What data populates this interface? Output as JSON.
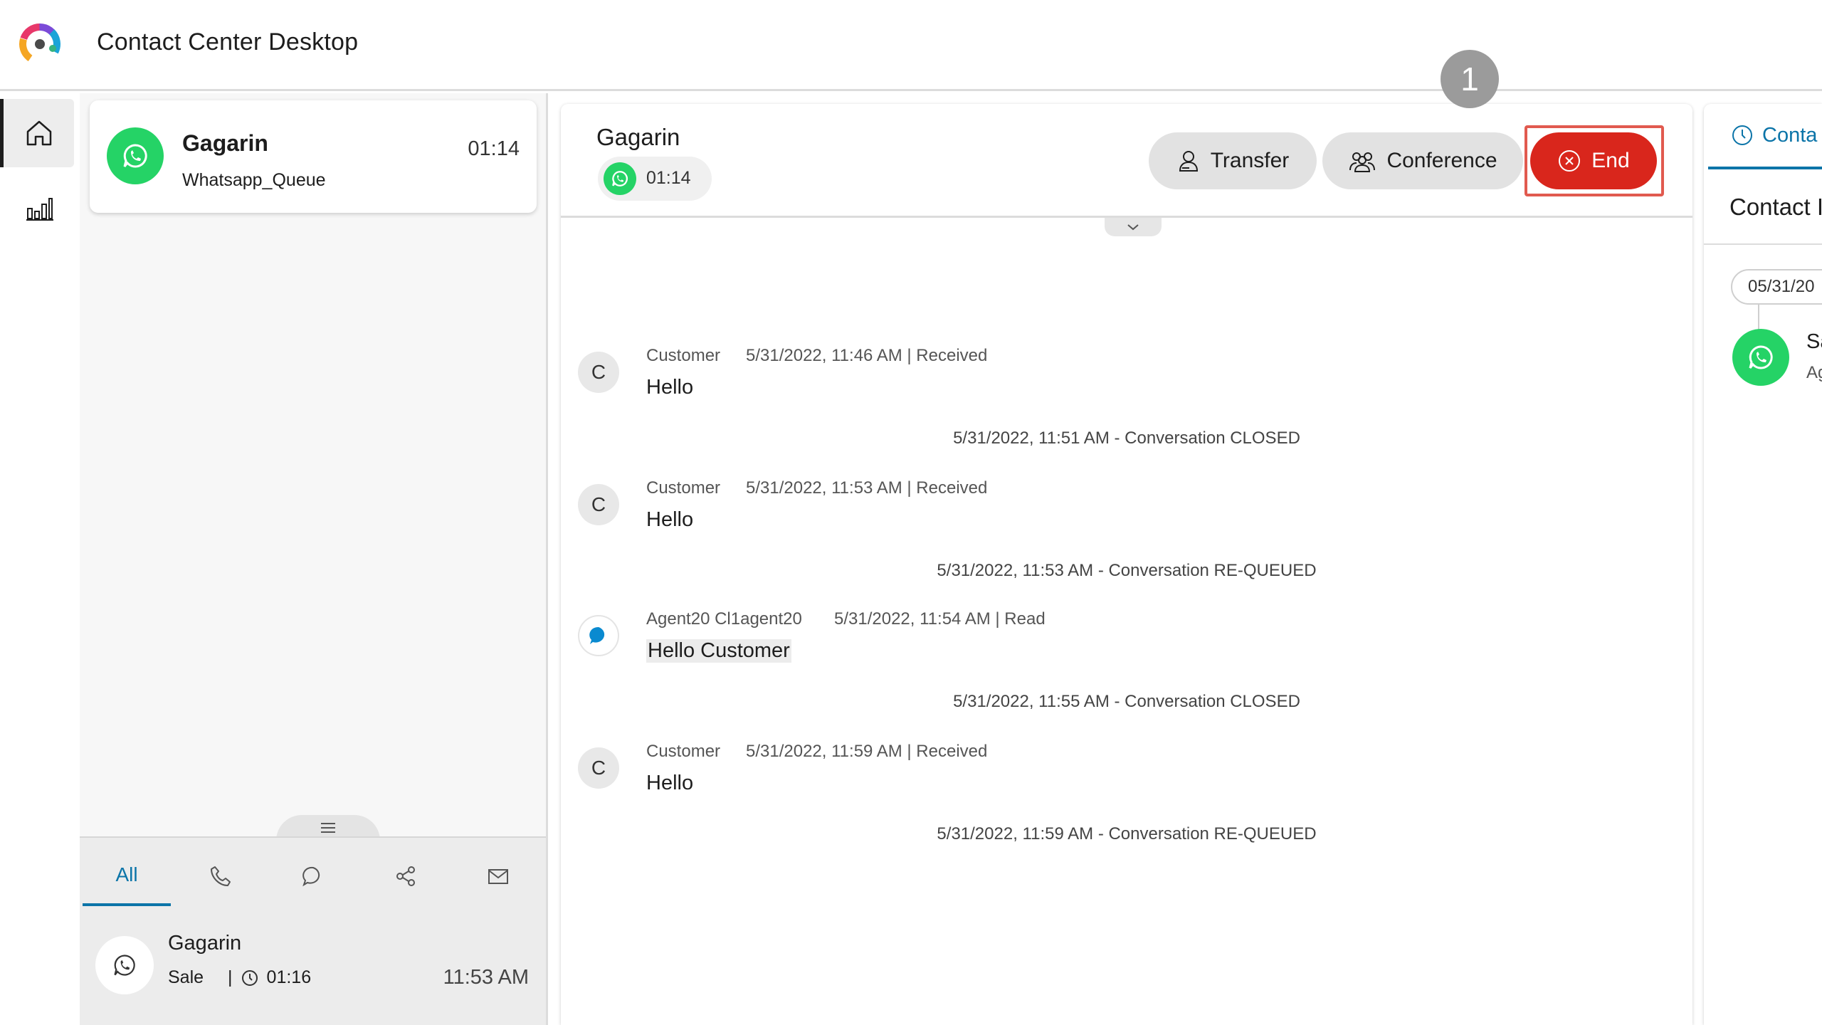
{
  "app": {
    "title": "Contact Center Desktop"
  },
  "task": {
    "name": "Gagarin",
    "queue": "Whatsapp_Queue",
    "timer": "01:14"
  },
  "drawer": {
    "tabs": [
      {
        "label": "All",
        "active": true
      },
      {
        "icon": "phone-icon"
      },
      {
        "icon": "chat-icon"
      },
      {
        "icon": "social-icon"
      },
      {
        "icon": "email-icon"
      }
    ],
    "history": {
      "name": "Gagarin",
      "label": "Sale",
      "separator": "|",
      "duration": "01:16",
      "time": "11:53 AM"
    }
  },
  "interaction": {
    "title": "Gagarin",
    "timer": "01:14",
    "buttons": {
      "transfer": "Transfer",
      "conference": "Conference",
      "end": "End"
    },
    "step_badge": "1",
    "messages": [
      {
        "kind": "msg",
        "avatar": "C",
        "sender": "Customer",
        "meta": "5/31/2022, 11:46 AM | Received",
        "text": "Hello"
      },
      {
        "kind": "sys",
        "text": "5/31/2022, 11:51 AM - Conversation CLOSED"
      },
      {
        "kind": "msg",
        "avatar": "C",
        "sender": "Customer",
        "meta": "5/31/2022, 11:53 AM | Received",
        "text": "Hello"
      },
      {
        "kind": "sys",
        "text": "5/31/2022, 11:53 AM - Conversation RE-QUEUED"
      },
      {
        "kind": "msg",
        "avatar": "agent",
        "sender": "Agent20 Cl1agent20",
        "meta": "5/31/2022, 11:54 AM | Read",
        "text": "Hello Customer"
      },
      {
        "kind": "sys",
        "text": "5/31/2022, 11:55 AM - Conversation CLOSED"
      },
      {
        "kind": "msg",
        "avatar": "C",
        "sender": "Customer",
        "meta": "5/31/2022, 11:59 AM | Received",
        "text": "Hello"
      },
      {
        "kind": "sys",
        "text": "5/31/2022, 11:59 AM - Conversation RE-QUEUED"
      }
    ]
  },
  "right_panel": {
    "tab_label": "Conta",
    "heading": "Contact I",
    "date": "05/31/20",
    "entry_name": "Sa",
    "entry_sub": "Ag"
  },
  "colors": {
    "whatsapp": "#25d366",
    "end_button": "#d9261c",
    "accent": "#0b74a8",
    "highlight_frame": "#e15a4f"
  }
}
